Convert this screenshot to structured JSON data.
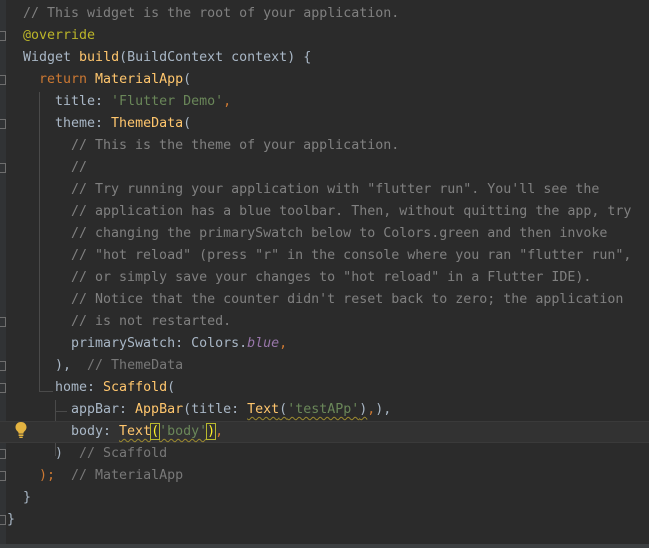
{
  "editor": {
    "lines": [
      {
        "indent": "",
        "tokens": [
          {
            "t": "// This widget is the root of your application.",
            "c": "cm"
          }
        ]
      },
      {
        "indent": "",
        "tokens": [
          {
            "t": "@override",
            "c": "ann"
          }
        ]
      },
      {
        "indent": "",
        "tokens": [
          {
            "t": "Widget ",
            "c": "prm"
          },
          {
            "t": "build",
            "c": "fn"
          },
          {
            "t": "(BuildContext context) {",
            "c": "prm"
          }
        ]
      },
      {
        "indent": "  ",
        "tokens": [
          {
            "t": "return ",
            "c": "kw"
          },
          {
            "t": "MaterialApp",
            "c": "fn"
          },
          {
            "t": "(",
            "c": "prm"
          }
        ]
      },
      {
        "indent": "    ",
        "tokens": [
          {
            "t": "title: ",
            "c": "prm"
          },
          {
            "t": "'Flutter Demo'",
            "c": "str"
          },
          {
            "t": ",",
            "c": "kw"
          }
        ]
      },
      {
        "indent": "    ",
        "tokens": [
          {
            "t": "theme: ",
            "c": "prm"
          },
          {
            "t": "ThemeData",
            "c": "fn"
          },
          {
            "t": "(",
            "c": "prm"
          }
        ]
      },
      {
        "indent": "      ",
        "tokens": [
          {
            "t": "// This is the theme of your application.",
            "c": "cm"
          }
        ]
      },
      {
        "indent": "      ",
        "tokens": [
          {
            "t": "//",
            "c": "cm"
          }
        ]
      },
      {
        "indent": "      ",
        "tokens": [
          {
            "t": "// Try running your application with \"flutter run\". You'll see the",
            "c": "cm"
          }
        ]
      },
      {
        "indent": "      ",
        "tokens": [
          {
            "t": "// application has a blue toolbar. Then, without quitting the app, try",
            "c": "cm"
          }
        ]
      },
      {
        "indent": "      ",
        "tokens": [
          {
            "t": "// changing the primarySwatch below to Colors.green and then invoke",
            "c": "cm"
          }
        ]
      },
      {
        "indent": "      ",
        "tokens": [
          {
            "t": "// \"hot reload\" (press \"r\" in the console where you ran \"flutter run\",",
            "c": "cm"
          }
        ]
      },
      {
        "indent": "      ",
        "tokens": [
          {
            "t": "// or simply save your changes to \"hot reload\" in a Flutter IDE).",
            "c": "cm"
          }
        ]
      },
      {
        "indent": "      ",
        "tokens": [
          {
            "t": "// Notice that the counter didn't reset back to zero; the application",
            "c": "cm"
          }
        ]
      },
      {
        "indent": "      ",
        "tokens": [
          {
            "t": "// is not restarted.",
            "c": "cm"
          }
        ]
      },
      {
        "indent": "      ",
        "tokens": [
          {
            "t": "primarySwatch: Colors.",
            "c": "prm"
          },
          {
            "t": "blue",
            "c": "it"
          },
          {
            "t": ",",
            "c": "kw"
          }
        ]
      },
      {
        "indent": "    ",
        "tokens": [
          {
            "t": "), ",
            "c": "prm"
          },
          {
            "t": " // ThemeData",
            "c": "hint"
          }
        ]
      },
      {
        "indent": "    ",
        "tokens": [
          {
            "t": "home: ",
            "c": "prm"
          },
          {
            "t": "Scaffold",
            "c": "fn"
          },
          {
            "t": "(",
            "c": "prm"
          }
        ]
      },
      {
        "indent": "      ",
        "tokens": [
          {
            "t": "appBar: ",
            "c": "prm"
          },
          {
            "t": "AppBar",
            "c": "fn"
          },
          {
            "t": "(title: ",
            "c": "prm"
          },
          {
            "t": "Text",
            "c": "fn squig"
          },
          {
            "t": "(",
            "c": "prm squig"
          },
          {
            "t": "'testAPp'",
            "c": "str squig"
          },
          {
            "t": ")",
            "c": "prm squig"
          },
          {
            "t": ",",
            "c": "kw"
          },
          {
            "t": "),",
            "c": "prm"
          }
        ]
      },
      {
        "indent": "      ",
        "current": true,
        "tokens": [
          {
            "t": "body: ",
            "c": "prm"
          },
          {
            "t": "Text",
            "c": "fn squig"
          },
          {
            "t": "(",
            "c": "brace-hl"
          },
          {
            "t": "'body'",
            "c": "str squig"
          },
          {
            "t": ")",
            "c": "brace-hl"
          },
          {
            "t": ",",
            "c": "kw"
          }
        ]
      },
      {
        "indent": "    ",
        "tokens": [
          {
            "t": ")",
            "c": "prm"
          },
          {
            "t": "  // Scaffold",
            "c": "hint"
          }
        ]
      },
      {
        "indent": "  ",
        "tokens": [
          {
            "t": ");",
            "c": "kw"
          },
          {
            "t": "  // MaterialApp",
            "c": "hint"
          }
        ]
      },
      {
        "indent": "",
        "tokens": [
          {
            "t": "}",
            "c": "prm"
          }
        ]
      },
      {
        "indent": "",
        "tokens": [
          {
            "t": "}",
            "c": "prm"
          }
        ],
        "outdent": true
      }
    ]
  },
  "icons": {
    "intention_bulb": "lightbulb-icon"
  }
}
